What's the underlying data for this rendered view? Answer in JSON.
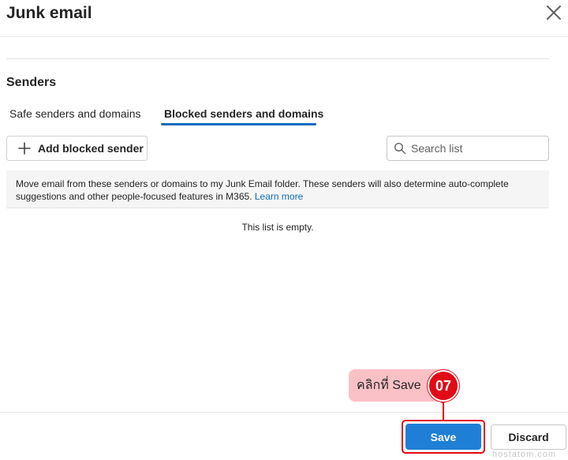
{
  "dialog": {
    "title": "Junk email",
    "close_icon": "close-icon"
  },
  "section": {
    "title": "Senders",
    "tabs": [
      {
        "label": "Safe senders and domains",
        "selected": false
      },
      {
        "label": "Blocked senders and domains",
        "selected": true
      }
    ]
  },
  "toolbar": {
    "add_label": "Add blocked sender",
    "add_icon": "plus-icon",
    "search_placeholder": "Search list",
    "search_value": "",
    "search_icon": "search-icon"
  },
  "info": {
    "text": "Move email from these senders or domains to my Junk Email folder. These senders will also determine auto-complete suggestions and other people-focused features in M365.",
    "link": "Learn more"
  },
  "list": {
    "empty_text": "This list is empty."
  },
  "callout": {
    "text": "คลิกที่ Save",
    "step": "07",
    "color": "#e20a17",
    "bubble_color": "#f9c1c6"
  },
  "footer": {
    "save_label": "Save",
    "discard_label": "Discard"
  },
  "watermark": "hostatom.com",
  "colors": {
    "accent": "#0f6cbd",
    "primary_button": "#1f7fd6"
  }
}
